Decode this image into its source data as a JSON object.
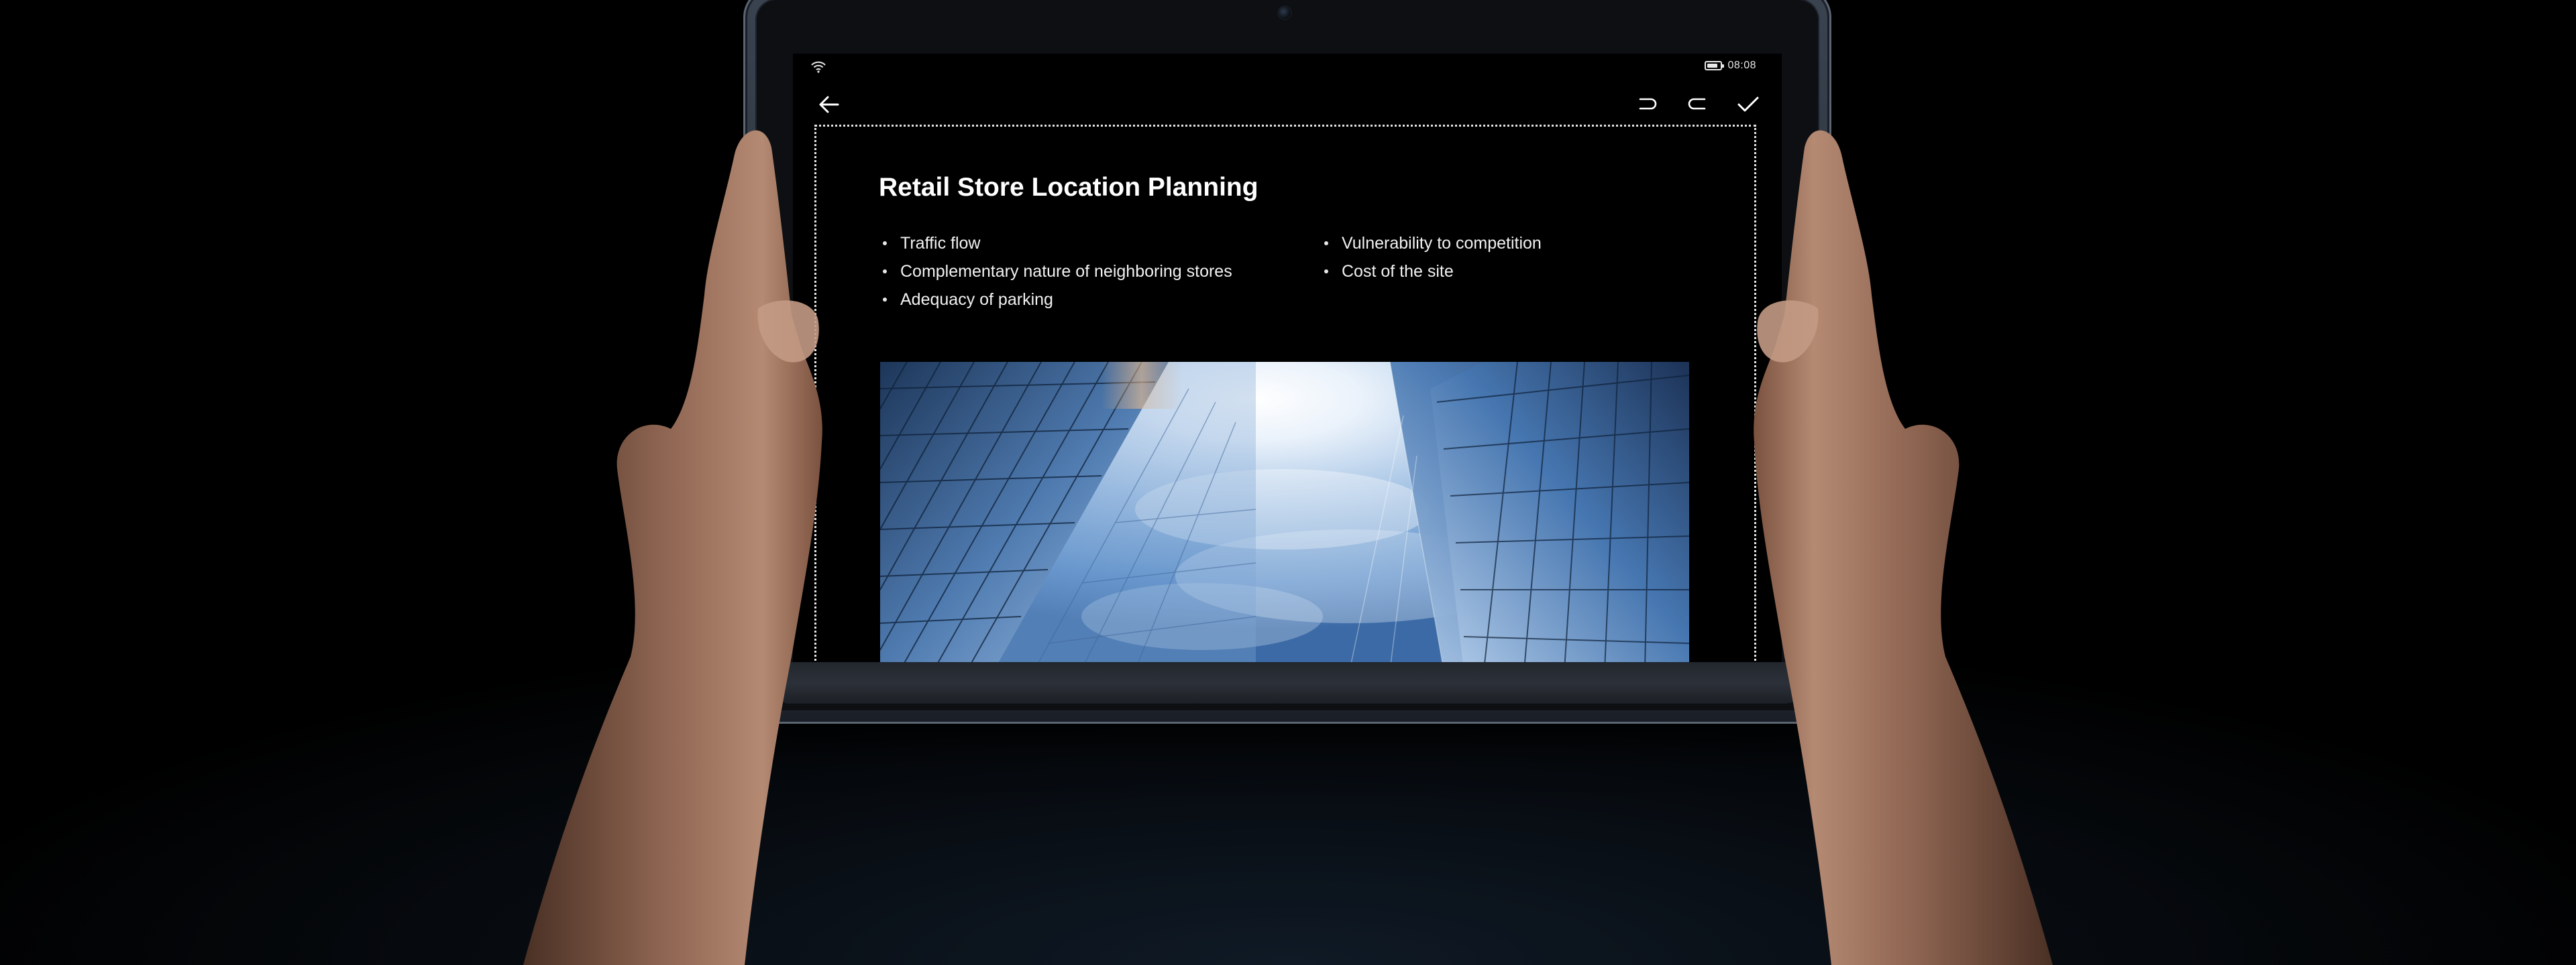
{
  "status_bar": {
    "time": "08:08",
    "battery_level": 0.8,
    "wifi_icon": "wifi-icon",
    "battery_icon": "battery-icon"
  },
  "toolbar": {
    "back_icon": "arrow-left-icon",
    "undo_icon": "undo-icon",
    "redo_icon": "redo-icon",
    "confirm_icon": "checkmark-icon"
  },
  "slide": {
    "title": "Retail Store Location Planning",
    "bullets_left": [
      "Traffic flow",
      "Complementary nature of neighboring stores",
      "Adequacy of parking"
    ],
    "bullets_right": [
      "Vulnerability to competition",
      "Cost of the site"
    ]
  },
  "colors": {
    "background": "#000000",
    "tablet_frame": "#2e3540",
    "screen": "#000000",
    "text": "#ffffff",
    "sky_blue": "#5d8fc9"
  }
}
